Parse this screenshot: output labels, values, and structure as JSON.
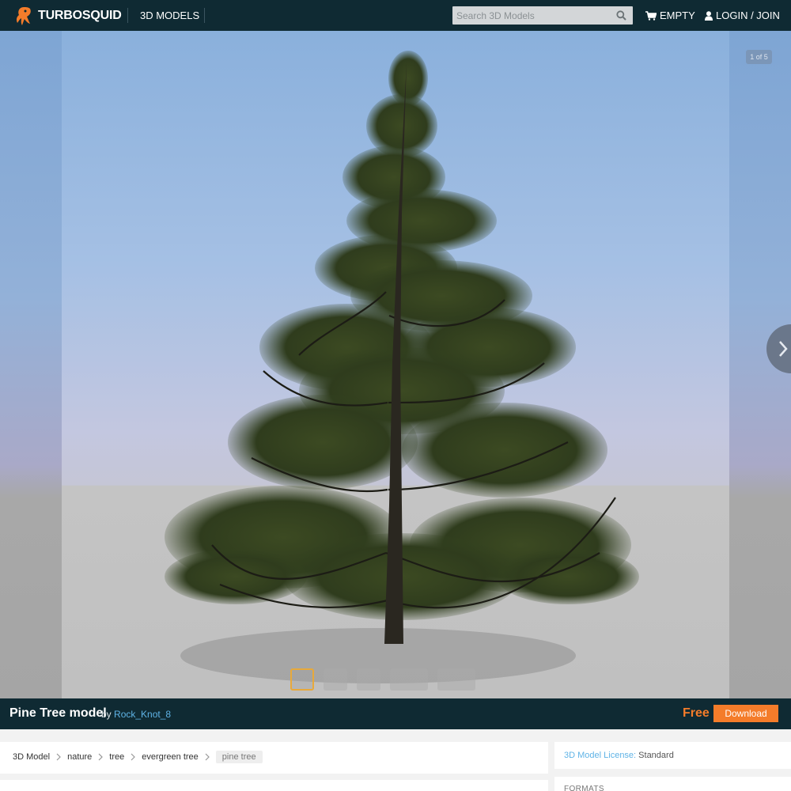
{
  "brand": {
    "name": "TURBOSQUID"
  },
  "nav": {
    "models_label": "3D MODELS",
    "search_placeholder": "Search 3D Models",
    "cart_label": "EMPTY",
    "login_label": "LOGIN / JOIN"
  },
  "viewer": {
    "counter": "1 of 5",
    "thumbnails": [
      "tree-front",
      "tree-silhouette",
      "tree-wire",
      "tree-scene",
      "tree-grey"
    ]
  },
  "product": {
    "title": "Pine Tree model",
    "by": "by",
    "author": "Rock_Knot_8",
    "price": "Free",
    "download_label": "Download"
  },
  "breadcrumb": [
    "3D Model",
    "nature",
    "tree",
    "evergreen tree",
    "pine tree"
  ],
  "license": {
    "label": "3D Model License:",
    "value": "Standard"
  },
  "formats": {
    "title": "FORMATS"
  },
  "colors": {
    "nav_bg": "#0f2a33",
    "accent": "#f47c2a",
    "link": "#5fb3e6"
  }
}
